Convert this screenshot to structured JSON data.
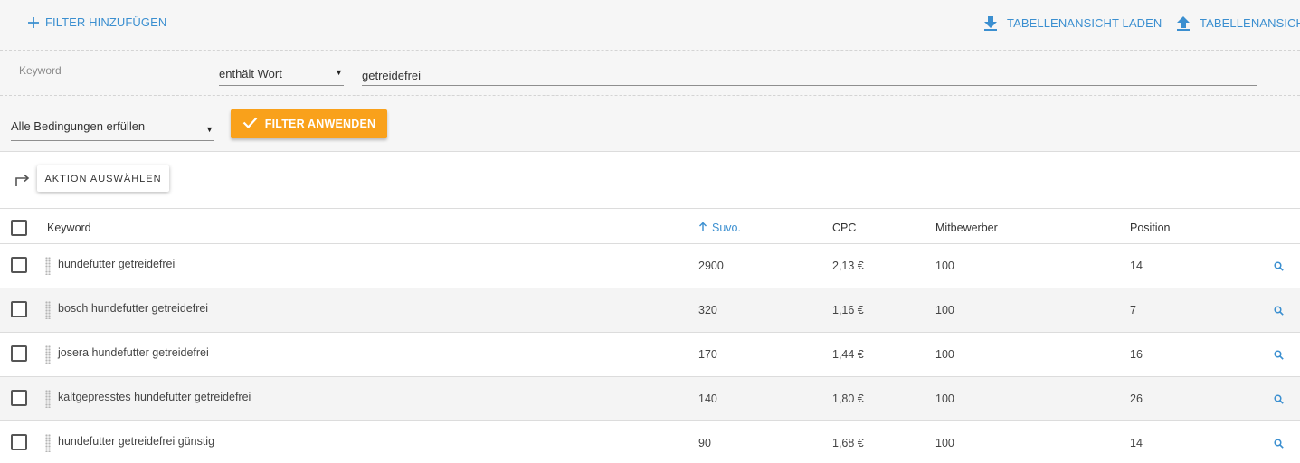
{
  "toolbar": {
    "add_filter_label": "FILTER HINZUFÜGEN",
    "load_view_label": "TABELLENANSICHT LADEN",
    "save_view_label": "TABELLENANSICHT"
  },
  "filter": {
    "field_label": "Keyword",
    "operator": "enthält Wort",
    "value": "getreidefrei",
    "match_mode": "Alle Bedingungen erfüllen",
    "apply_label": "FILTER ANWENDEN"
  },
  "actions": {
    "select_action_label": "AKTION AUSWÄHLEN"
  },
  "table": {
    "headers": {
      "keyword": "Keyword",
      "volume": "Suvo.",
      "cpc": "CPC",
      "competitors": "Mitbewerber",
      "position": "Position"
    },
    "sort": {
      "column": "volume",
      "direction": "ascending-arrow"
    },
    "rows": [
      {
        "keyword": "hundefutter getreidefrei",
        "volume": "2900",
        "cpc": "2,13 €",
        "competitors": "100",
        "position": "14"
      },
      {
        "keyword": "bosch hundefutter getreidefrei",
        "volume": "320",
        "cpc": "1,16 €",
        "competitors": "100",
        "position": "7"
      },
      {
        "keyword": "josera hundefutter getreidefrei",
        "volume": "170",
        "cpc": "1,44 €",
        "competitors": "100",
        "position": "16"
      },
      {
        "keyword": "kaltgepresstes hundefutter getreidefrei",
        "volume": "140",
        "cpc": "1,80 €",
        "competitors": "100",
        "position": "26"
      },
      {
        "keyword": "hundefutter getreidefrei günstig",
        "volume": "90",
        "cpc": "1,68 €",
        "competitors": "100",
        "position": "14"
      }
    ]
  },
  "icons": {
    "add": "plus-icon",
    "load": "download-icon",
    "save": "upload-icon",
    "apply": "check-icon",
    "action": "redo-arrow-icon",
    "sort": "arrow-up-icon",
    "row_search": "search-icon",
    "drag": "drag-handle-icon"
  },
  "colors": {
    "accent_blue": "#3b8fd0",
    "apply_orange": "#f9a11b",
    "panel_background": "#f6f6f6",
    "row_alt_background": "#f4f4f4"
  }
}
